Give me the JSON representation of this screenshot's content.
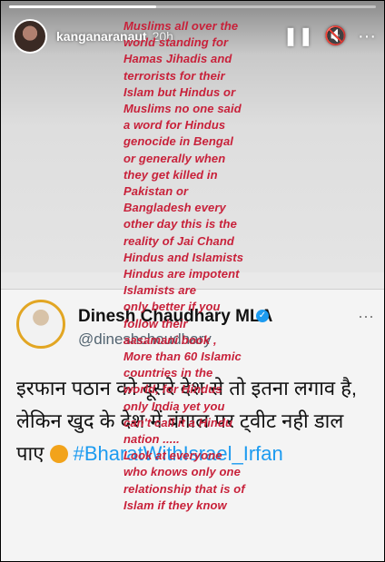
{
  "story": {
    "username": "kanganaranaut",
    "time": "20h",
    "progress": 0.4,
    "controls": {
      "pause": "❚❚",
      "mute": "🔇",
      "more": "···"
    }
  },
  "overlay_lines": [
    "Muslims all over the",
    "world standing for",
    "Hamas Jihadis and",
    "terrorists for their",
    "Islam but Hindus or",
    "Muslims no one said",
    "a word for Hindus",
    "genocide in Bengal",
    "or generally when",
    "they get killed in",
    "Pakistan or",
    "Bangladesh every",
    "other day this is the",
    "reality of Jai Chand",
    "Hindus and Islamists",
    "Hindus are  impotent",
    "Islamists are",
    "only better if you",
    "follow their",
    "aasamani book ,",
    "More than 60 Islamic",
    "countries in the",
    "world, for Hindus",
    "only India yet you",
    "can't call it a Hindu",
    "nation .....",
    "Look at everyone",
    "who knows only one",
    "relationship that is of",
    "Islam if they know"
  ],
  "tweet": {
    "name": "Dinesh Chaudhary MLA",
    "handle": "@dineshchoudhary",
    "more": "···",
    "text_main": "इरफान पठान को दूसरे देश से तो इतना लगाव है, लेकिन खुद के देश में बंगाल पर ट्वीट नही डाल पाए",
    "hashtag": "#BharatWithIsrael_Irfan"
  }
}
